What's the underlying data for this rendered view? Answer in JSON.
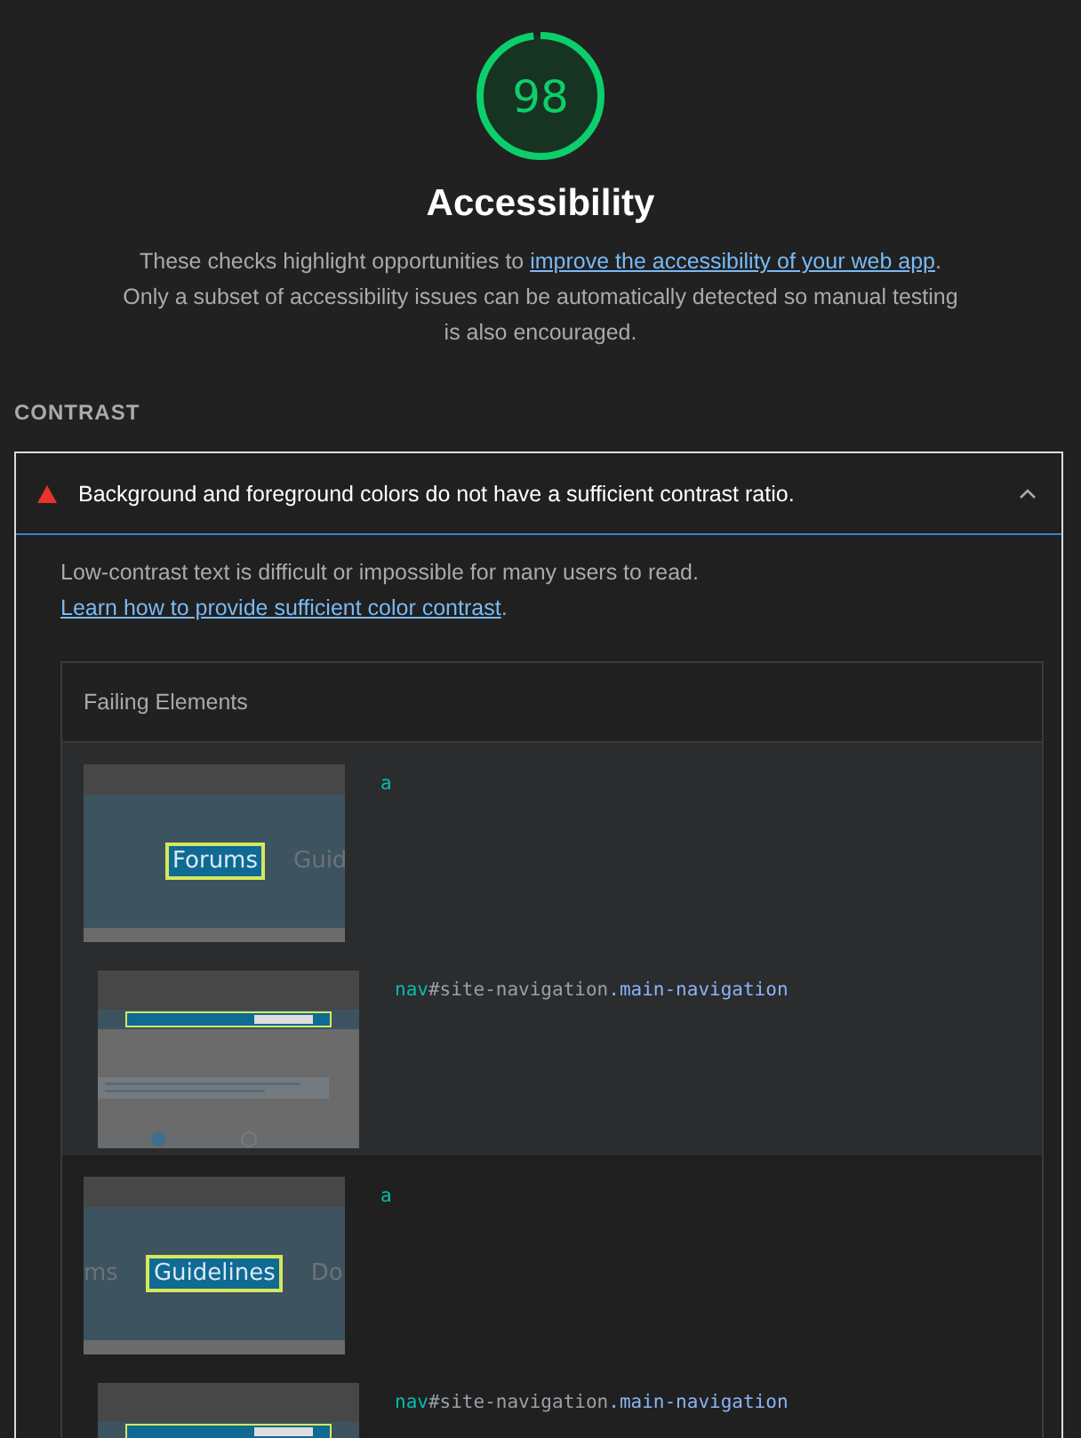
{
  "gauge": {
    "score": "98",
    "level": 0.98
  },
  "title": "Accessibility",
  "description": [
    {
      "kind": "text",
      "text": "These checks highlight opportunities to "
    },
    {
      "kind": "link",
      "text": "improve the accessibility of your web app"
    },
    {
      "kind": "text",
      "text": ". Only a subset of accessibility issues can be automatically detected so manual testing is also encouraged."
    }
  ],
  "group_title": "CONTRAST",
  "audit": {
    "title": "Background and foreground colors do not have a sufficient contrast ratio.",
    "expanded": true,
    "description": [
      {
        "kind": "text",
        "text": "Low-contrast text is difficult or impossible for many users to read. "
      },
      {
        "kind": "link",
        "text": "Learn how to provide sufficient color contrast"
      },
      {
        "kind": "text",
        "text": "."
      }
    ],
    "table_title": "Failing Elements",
    "items": [
      {
        "snapshot": [
          {
            "label": "Forums",
            "highlighted": true
          },
          {
            "label": "Guid",
            "highlighted": false
          }
        ],
        "node": "a",
        "selector": [
          {
            "kind": "tag",
            "text": "nav"
          },
          {
            "kind": "id",
            "text": "#site-navigation"
          },
          {
            "kind": "class",
            "text": ".main-navigation"
          }
        ]
      },
      {
        "snapshot": [
          {
            "label": "ms",
            "highlighted": false
          },
          {
            "label": "Guidelines",
            "highlighted": true
          },
          {
            "label": "Do",
            "highlighted": false
          }
        ],
        "node": "a",
        "selector": [
          {
            "kind": "tag",
            "text": "nav"
          },
          {
            "kind": "id",
            "text": "#site-navigation"
          },
          {
            "kind": "class",
            "text": ".main-navigation"
          }
        ]
      }
    ]
  }
}
